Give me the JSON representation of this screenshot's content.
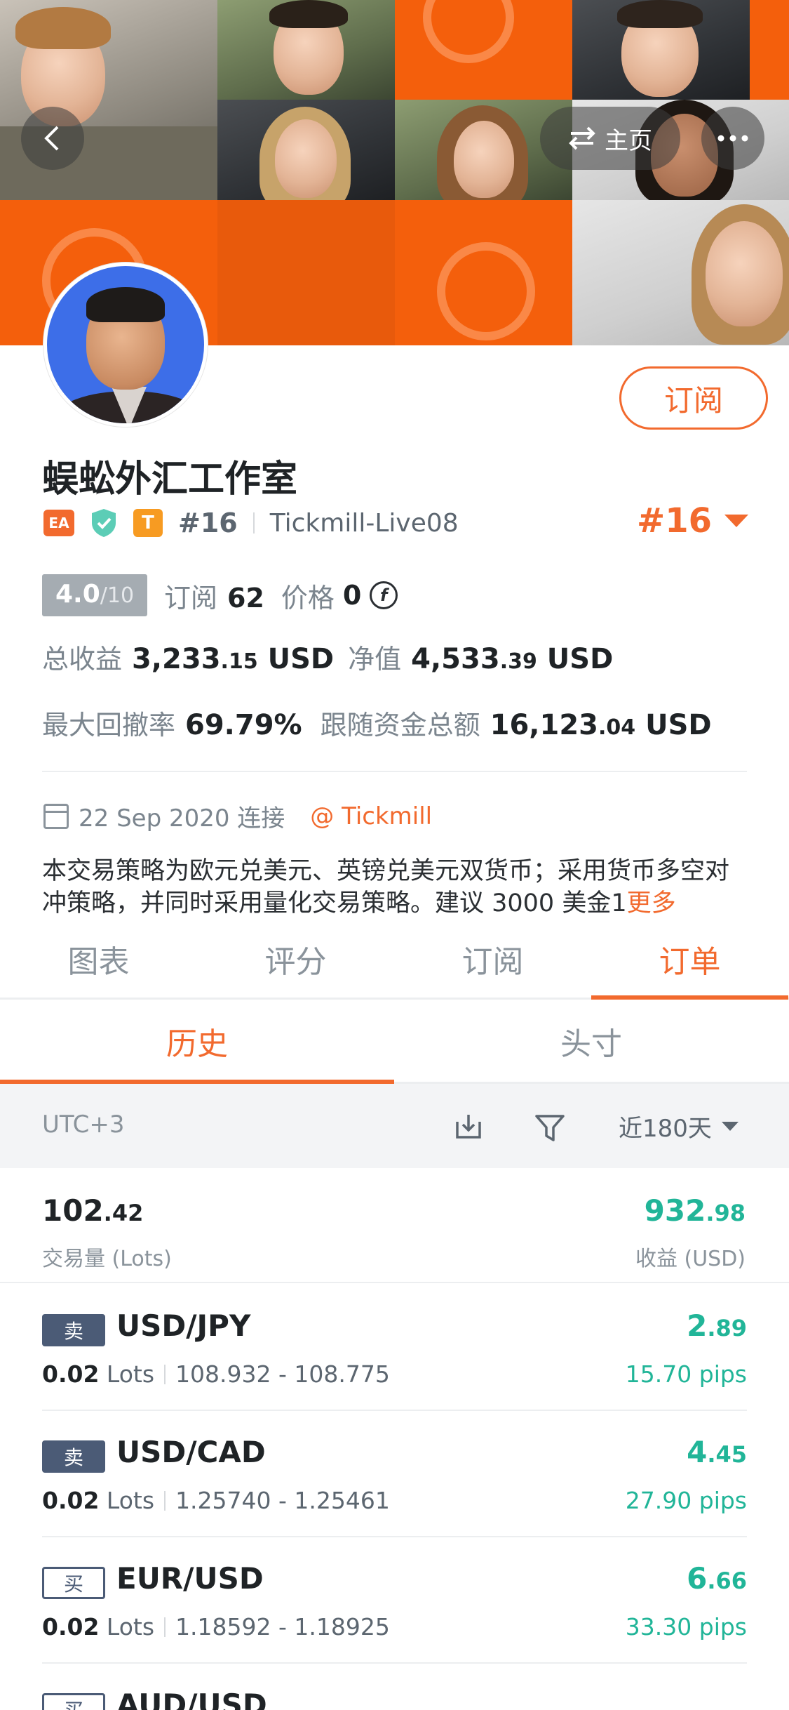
{
  "header": {
    "home_label": "主页"
  },
  "profile": {
    "name": "蜈蚣外汇工作室",
    "subscribe_label": "订阅",
    "badge_ea": "EA",
    "badge_t": "T",
    "rank_small": "#16",
    "broker_account": "Tickmill-Live08",
    "rank_big": "#16",
    "score": "4.0",
    "score_max": "/10",
    "subscriptions_label": "订阅",
    "subscriptions_value": "62",
    "price_label": "价格",
    "price_value": "0",
    "total_profit_label": "总收益",
    "total_profit_int": "3,233",
    "total_profit_dec": ".15",
    "total_profit_unit": "USD",
    "equity_label": "净值",
    "equity_int": "4,533",
    "equity_dec": ".39",
    "equity_unit": "USD",
    "max_drawdown_label": "最大回撤率",
    "max_drawdown_value": "69.79%",
    "follow_funds_label": "跟随资金总额",
    "follow_funds_int": "16,123",
    "follow_funds_dec": ".04",
    "follow_funds_unit": "USD",
    "connected_date": "22 Sep 2020 连接",
    "broker_tag": "@ Tickmill",
    "description": "本交易策略为欧元兑美元、英镑兑美元双货币；采用货币多空对冲策略，并同时采用量化交易策略。建议 3000 美金1",
    "more_label": "更多"
  },
  "main_tabs": [
    {
      "label": "图表",
      "active": false
    },
    {
      "label": "评分",
      "active": false
    },
    {
      "label": "订阅",
      "active": false
    },
    {
      "label": "订单",
      "active": true
    }
  ],
  "sub_tabs": [
    {
      "label": "历史",
      "active": true
    },
    {
      "label": "头寸",
      "active": false
    }
  ],
  "filter": {
    "timezone": "UTC+3",
    "range": "近180天"
  },
  "summary": {
    "lots_int": "102",
    "lots_dec": ".42",
    "lots_label": "交易量 (Lots)",
    "profit_int": "932",
    "profit_dec": ".98",
    "profit_label": "收益 (USD)"
  },
  "trades": [
    {
      "type": "卖",
      "side": "sell",
      "pair": "USD/JPY",
      "lots": "0.02",
      "lots_unit": "Lots",
      "prices": "108.932 - 108.775",
      "profit_int": "2",
      "profit_dec": ".89",
      "pips": "15.70 pips"
    },
    {
      "type": "卖",
      "side": "sell",
      "pair": "USD/CAD",
      "lots": "0.02",
      "lots_unit": "Lots",
      "prices": "1.25740 - 1.25461",
      "profit_int": "4",
      "profit_dec": ".45",
      "pips": "27.90 pips"
    },
    {
      "type": "买",
      "side": "buy",
      "pair": "EUR/USD",
      "lots": "0.02",
      "lots_unit": "Lots",
      "prices": "1.18592 - 1.18925",
      "profit_int": "6",
      "profit_dec": ".66",
      "pips": "33.30 pips"
    },
    {
      "type": "买",
      "side": "buy",
      "pair": "AUD/USD",
      "lots": "",
      "lots_unit": "",
      "prices": "",
      "profit_int": "",
      "profit_dec": "",
      "pips": ""
    }
  ],
  "colors": {
    "accent": "#f26a2e",
    "profit_green": "#21b598",
    "sell_badge": "#4b5b76"
  }
}
